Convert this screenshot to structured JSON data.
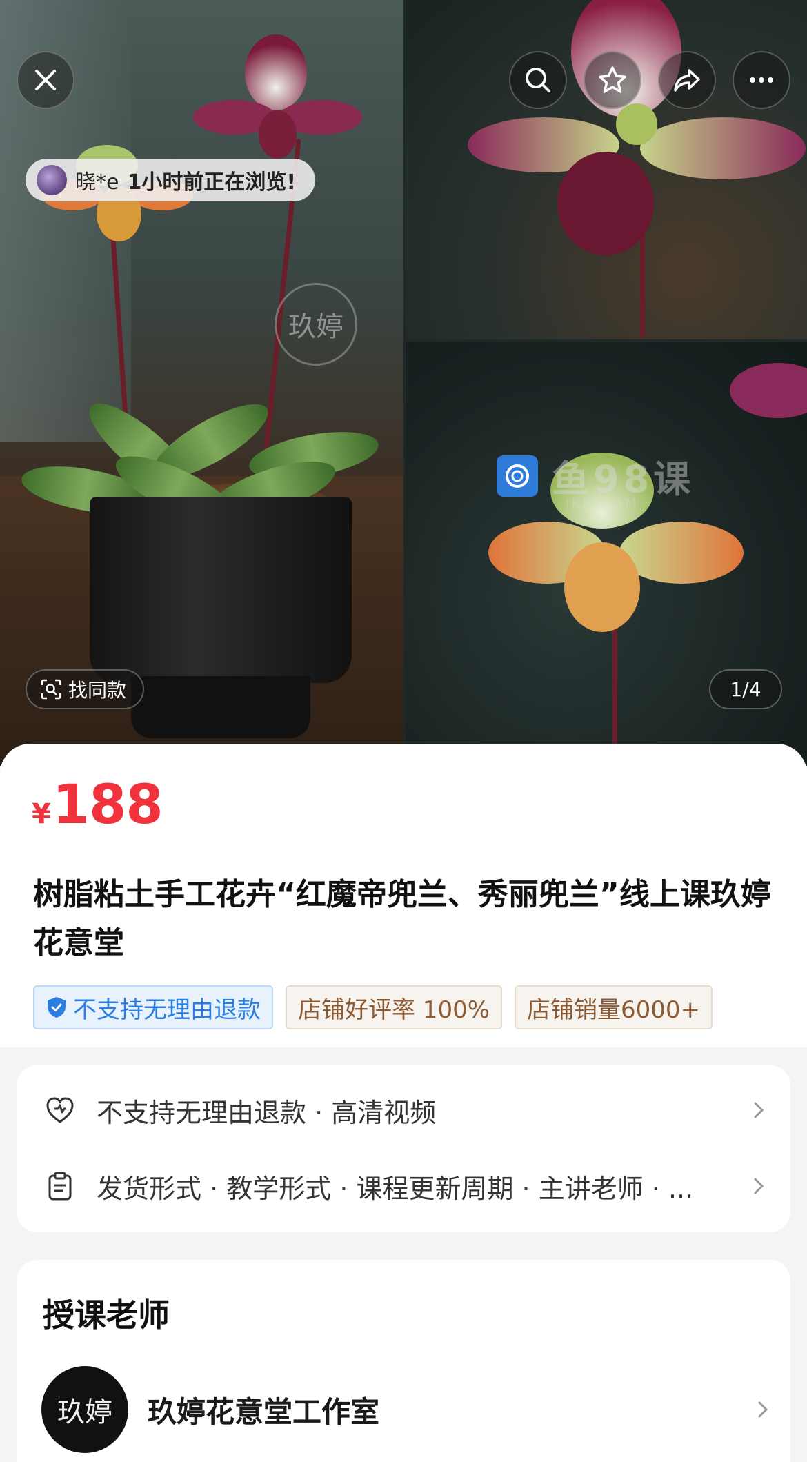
{
  "gallery": {
    "browsing_user": "晓*e",
    "browsing_text": "1小时前正在浏览!",
    "find_same_label": "找同款",
    "image_counter": "1/4",
    "watermark_seal": "玖婷",
    "site_watermark": "鱼98课",
    "site_watermark_sub": "IKE.COM"
  },
  "top_actions": {
    "close_icon": "close-icon",
    "search_icon": "search-icon",
    "favorite_icon": "star-icon",
    "share_icon": "share-icon",
    "more_icon": "more-icon"
  },
  "product": {
    "currency": "¥",
    "price": "188",
    "title": "树脂粘土手工花卉“红魔帝兜兰、秀丽兜兰”线上课玖婷花意堂",
    "tags": [
      {
        "label": "不支持无理由退款",
        "style": "blue"
      },
      {
        "label": "店铺好评率 100%",
        "style": "brown"
      },
      {
        "label": "店铺销量6000+",
        "style": "brown"
      }
    ]
  },
  "services": {
    "row1": "不支持无理由退款 · 高清视频",
    "row2": "发货形式 · 教学形式 · 课程更新周期 · 主讲老师 · ..."
  },
  "teacher": {
    "heading": "授课老师",
    "avatar_text": "玖婷",
    "name": "玖婷花意堂工作室"
  },
  "colors": {
    "price_red": "#f0323c",
    "tag_blue": "#2a7de1",
    "tag_brown": "#8c5a33"
  }
}
